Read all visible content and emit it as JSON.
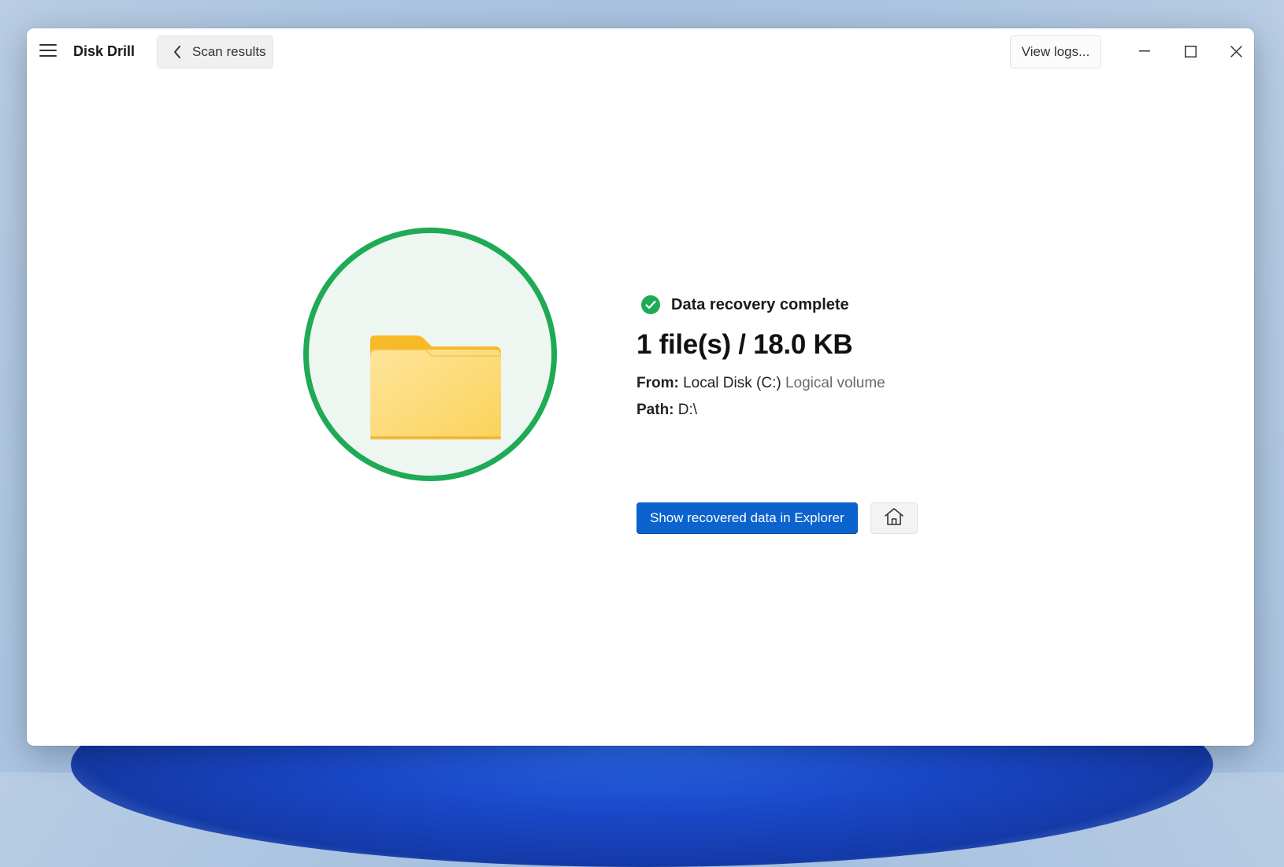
{
  "app": {
    "title": "Disk Drill"
  },
  "header": {
    "back_label": "Scan results",
    "logs_label": "View logs..."
  },
  "result": {
    "status": "Data recovery complete",
    "summary": "1 file(s) / 18.0 KB",
    "from_label": "From:",
    "from_value": "Local Disk (C:)",
    "from_type": "Logical volume",
    "path_label": "Path:",
    "path_value": "D:\\"
  },
  "actions": {
    "show_explorer_label": "Show recovered data in Explorer"
  },
  "icons": {
    "menu": "hamburger-menu-icon",
    "back": "chevron-left-icon",
    "minimize": "minimize-icon",
    "maximize": "maximize-icon",
    "close": "close-icon",
    "status": "check-circle-icon",
    "folder": "folder-icon",
    "home": "home-icon"
  },
  "colors": {
    "accent": "#0b63ce",
    "success": "#1faa55",
    "folder": "#fcd25a"
  }
}
